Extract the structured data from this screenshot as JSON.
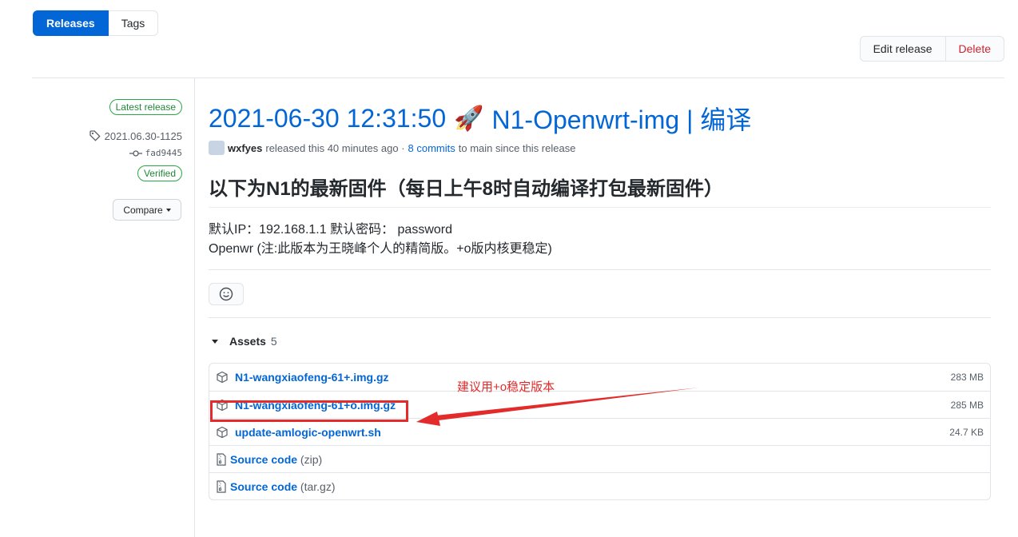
{
  "tabs": {
    "releases": "Releases",
    "tags": "Tags"
  },
  "actions": {
    "edit": "Edit release",
    "delete": "Delete"
  },
  "meta": {
    "latest_badge": "Latest release",
    "tag": "2021.06.30-1125",
    "commit": "fad9445",
    "verified": "Verified",
    "compare": "Compare"
  },
  "release": {
    "title_date": "2021-06-30 12:31:50",
    "title_emoji": "🚀",
    "title_name": "N1-Openwrt-img | 编译",
    "author": "wxfyes",
    "released_text": "released this 40 minutes ago ·",
    "commits_link": "8 commits",
    "commits_suffix": "to main since this release",
    "heading": "以下为N1的最新固件（每日上午8时自动编译打包最新固件）",
    "line1": "默认IP：192.168.1.1 默认密码： password",
    "line2": "Openwr (注:此版本为王晓峰个人的精简版。+o版内核更稳定)"
  },
  "assets": {
    "label": "Assets",
    "count": "5",
    "items": [
      {
        "name": "N1-wangxiaofeng-61+.img.gz",
        "size": "283 MB"
      },
      {
        "name": "N1-wangxiaofeng-61+o.img.gz",
        "size": "285 MB"
      },
      {
        "name": "update-amlogic-openwrt.sh",
        "size": "24.7 KB"
      }
    ],
    "source": [
      {
        "name": "Source code",
        "ext": "(zip)"
      },
      {
        "name": "Source code",
        "ext": "(tar.gz)"
      }
    ]
  },
  "annotation": "建议用+o稳定版本",
  "colors": {
    "accent": "#0366d6",
    "danger": "#cb2431",
    "success": "#28a745",
    "annotation": "#e32b2b"
  }
}
